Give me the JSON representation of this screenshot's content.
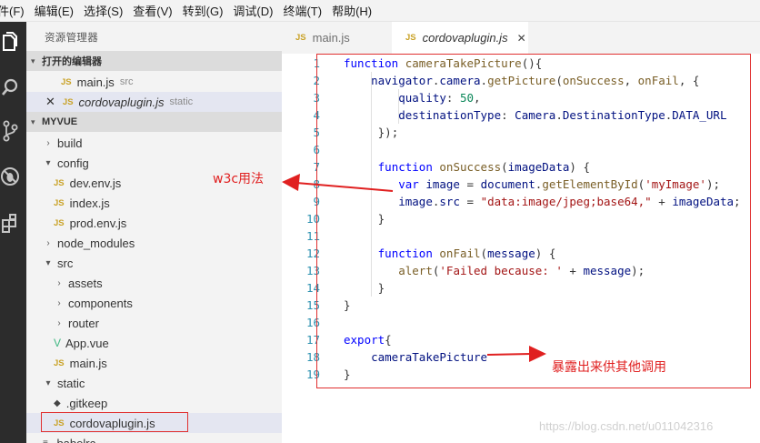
{
  "menu": [
    "件(F)",
    "编辑(E)",
    "选择(S)",
    "查看(V)",
    "转到(G)",
    "调试(D)",
    "终端(T)",
    "帮助(H)"
  ],
  "activity_icons": [
    "files-icon",
    "search-icon",
    "source-control-icon",
    "debug-icon",
    "extensions-icon"
  ],
  "sidebar": {
    "title": "资源管理器",
    "open_editors_label": "打开的编辑器",
    "open_editors": [
      {
        "name": "main.js",
        "desc": "src",
        "badge": "JS"
      },
      {
        "name": "cordovaplugin.js",
        "desc": "static",
        "badge": "JS",
        "close": "✕"
      }
    ],
    "project_label": "MYVUE",
    "tree": [
      {
        "name": "build",
        "type": "folder",
        "expanded": false
      },
      {
        "name": "config",
        "type": "folder",
        "expanded": true
      },
      {
        "name": "dev.env.js",
        "type": "js"
      },
      {
        "name": "index.js",
        "type": "js"
      },
      {
        "name": "prod.env.js",
        "type": "js"
      },
      {
        "name": "node_modules",
        "type": "folder",
        "expanded": false
      },
      {
        "name": "src",
        "type": "folder",
        "expanded": true
      },
      {
        "name": "assets",
        "type": "folder",
        "expanded": false
      },
      {
        "name": "components",
        "type": "folder",
        "expanded": false
      },
      {
        "name": "router",
        "type": "folder",
        "expanded": false
      },
      {
        "name": "App.vue",
        "type": "vue"
      },
      {
        "name": "main.js",
        "type": "js"
      },
      {
        "name": "static",
        "type": "folder",
        "expanded": true
      },
      {
        "name": ".gitkeep",
        "type": "git"
      },
      {
        "name": "cordovaplugin.js",
        "type": "js",
        "selected": true
      },
      {
        "name": ".babelrc",
        "type": "file"
      }
    ]
  },
  "tabs": [
    {
      "label": "main.js",
      "badge": "JS",
      "active": false
    },
    {
      "label": "cordovaplugin.js",
      "badge": "JS",
      "active": true,
      "close": "✕"
    }
  ],
  "code_lines": [
    "function cameraTakePicture(){",
    "    navigator.camera.getPicture(onSuccess, onFail, {",
    "        quality: 50,",
    "        destinationType: Camera.DestinationType.DATA_URL",
    "     });",
    "",
    "     function onSuccess(imageData) {",
    "        var image = document.getElementById('myImage');",
    "        image.src = \"data:image/jpeg;base64,\" + imageData;",
    "     }",
    "",
    "     function onFail(message) {",
    "        alert('Failed because: ' + message);",
    "     }",
    "}",
    "",
    "export{",
    "    cameraTakePicture",
    "}"
  ],
  "annotations": {
    "w3c": "w3c用法",
    "expose": "暴露出来供其他调用"
  },
  "watermark": "https://blog.csdn.net/u011042316",
  "colors": {
    "keyword": "#0000ff",
    "function": "#795e26",
    "variable": "#001080",
    "string": "#a31515",
    "number": "#098658",
    "line_number": "#2b91af",
    "annotation": "#e02020",
    "js_badge": "#c9a227"
  }
}
